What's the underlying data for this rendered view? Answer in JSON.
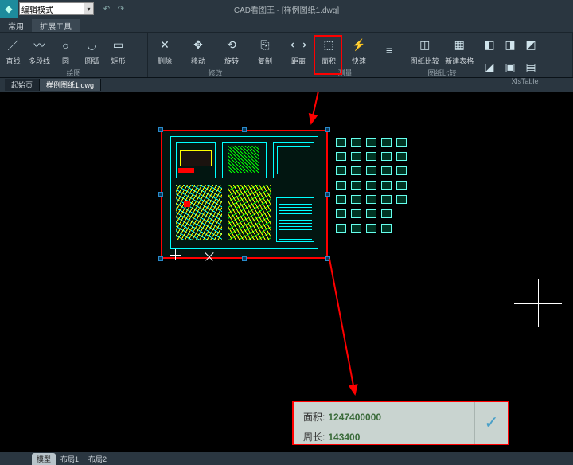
{
  "title": "CAD看图王 - [样例图纸1.dwg]",
  "mode": "编辑模式",
  "tabs": {
    "common": "常用",
    "extend": "扩展工具"
  },
  "ribbon": {
    "draw": {
      "label": "绘图",
      "line": "直线",
      "polyline": "多段线",
      "circle": "圆",
      "arc": "圆弧",
      "rect": "矩形"
    },
    "modify": {
      "label": "修改",
      "delete": "删除",
      "move": "移动",
      "rotate": "旋转",
      "copy": "复制"
    },
    "measure": {
      "label": "测量",
      "distance": "距离",
      "area": "面积",
      "quick": "快速",
      "more": ""
    },
    "compare": {
      "label": "图纸比较",
      "compare": "图纸比较",
      "newtable": "新建表格"
    },
    "xls": {
      "label": "XlsTable"
    }
  },
  "doctabs": {
    "start": "起始页",
    "doc": "样例图纸1.dwg"
  },
  "result": {
    "area_label": "面积:",
    "area_value": "1247400000",
    "perimeter_label": "周长:",
    "perimeter_value": "143400"
  },
  "layout_tabs": {
    "model": "模型",
    "layout1": "布局1",
    "layout2": "布局2"
  }
}
